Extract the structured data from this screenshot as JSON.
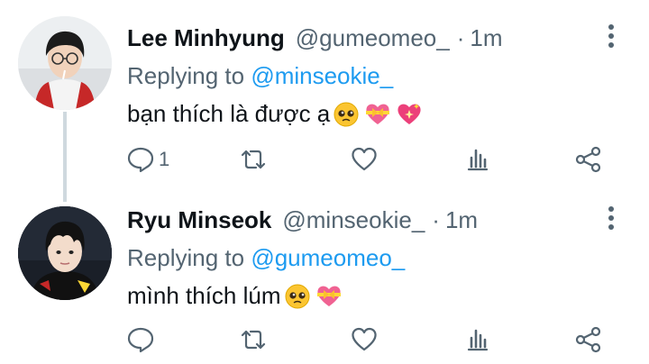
{
  "tweets": [
    {
      "name": "Lee Minhyung",
      "handle": "@gumeomeo_",
      "separator": "·",
      "time": "1m",
      "replying_prefix": "Replying to",
      "replying_to": "@minseokie_",
      "text": "bạn thích là được ạ",
      "emojis": [
        "pleading-face",
        "heart-with-ribbon",
        "sparkling-heart"
      ],
      "reply_count": "1"
    },
    {
      "name": "Ryu Minseok",
      "handle": "@minseokie_",
      "separator": "·",
      "time": "1m",
      "replying_prefix": "Replying to",
      "replying_to": "@gumeomeo_",
      "text": "mình thích lúm",
      "emojis": [
        "pleading-face",
        "heart-with-ribbon"
      ],
      "reply_count": ""
    }
  ],
  "colors": {
    "text": "#0f1419",
    "secondary": "#536471",
    "link": "#1d9bf0",
    "thread_line": "#cfd9de"
  }
}
